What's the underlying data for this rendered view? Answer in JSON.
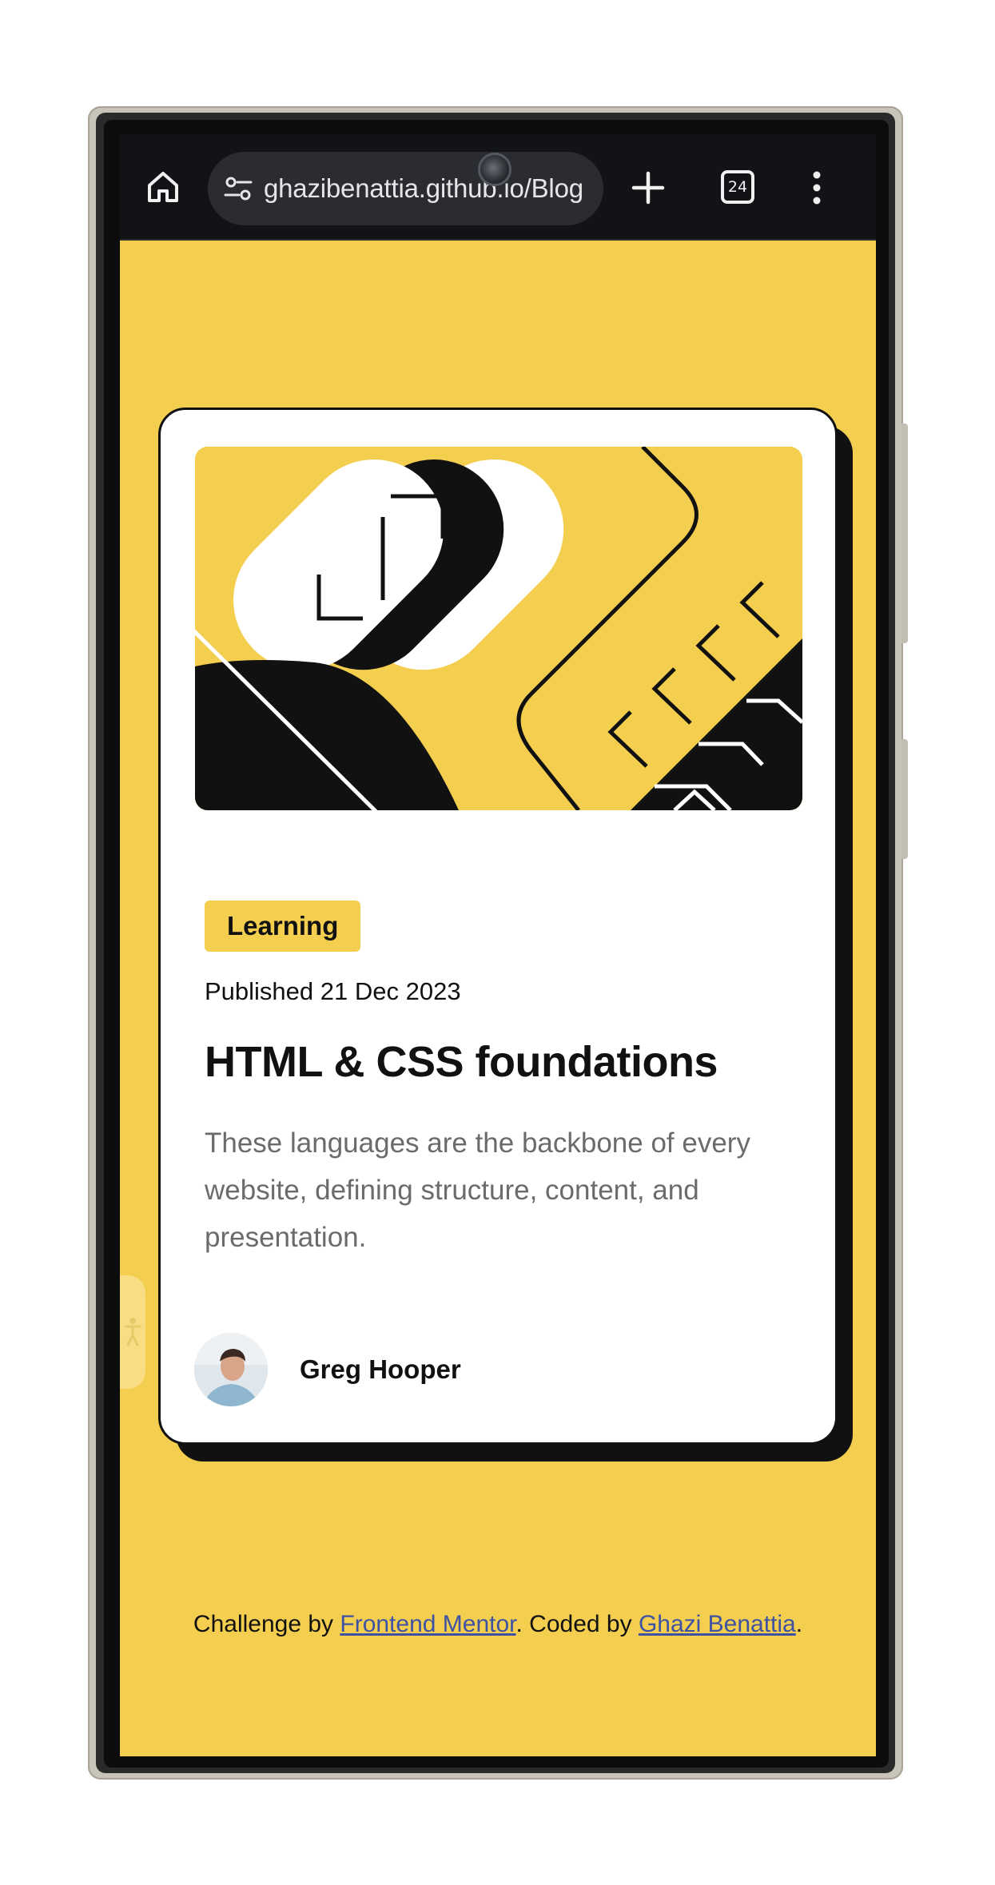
{
  "browser": {
    "url": "ghazibenattia.github.io/Blog-P",
    "tab_count": "24"
  },
  "card": {
    "category": "Learning",
    "published": "Published 21 Dec 2023",
    "title": "HTML & CSS foundations",
    "description": "These languages are the backbone of every website, defining structure, content, and presentation.",
    "author_name": "Greg Hooper"
  },
  "footer": {
    "prefix": "Challenge by ",
    "link1": "Frontend Mentor",
    "middle": ". Coded by ",
    "link2": "Ghazi Benattia",
    "suffix": "."
  },
  "icons": {
    "home": "home-icon",
    "tune": "tune-icon",
    "plus": "plus-icon",
    "tabs": "tabs-icon",
    "menu": "more-vert-icon",
    "accessibility": "accessibility-icon"
  },
  "colors": {
    "page_bg": "#f4ce4f",
    "card_bg": "#ffffff",
    "accent_text": "#111111",
    "muted_text": "#6b6b6b",
    "link": "#3e52a3",
    "browser_bar": "#121316"
  }
}
